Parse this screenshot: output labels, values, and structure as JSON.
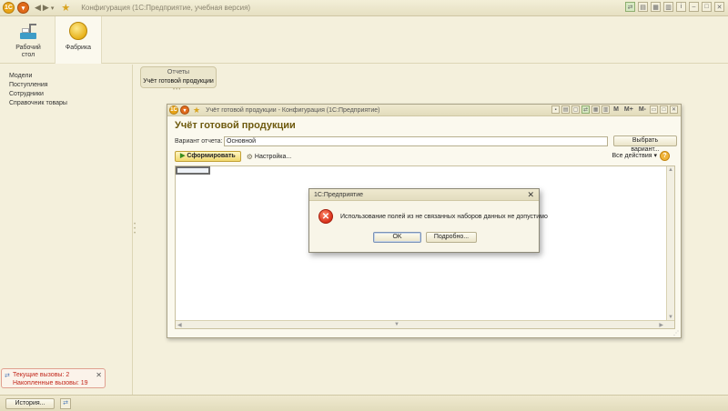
{
  "window": {
    "title": "Конфигурация  (1С:Предприятие, учебная версия)"
  },
  "sections": [
    {
      "label": "Рабочий стол",
      "icon": "desktop-icon",
      "active": false
    },
    {
      "label": "Фабрика",
      "icon": "coin-icon",
      "active": true
    }
  ],
  "sidebar": {
    "items": [
      "Модели",
      "Поступления",
      "Сотрудники",
      "Справочник товары"
    ]
  },
  "reports": {
    "header": "Отчеты",
    "item": "Учёт готовой продукции"
  },
  "form": {
    "window_title": "Учёт готовой продукции - Конфигурация  (1С:Предприятие)",
    "header": "Учёт готовой продукции",
    "variant_label": "Вариант отчета:",
    "variant_value": "Основной",
    "choose_variant": "Выбрать вариант...",
    "generate": "Сформировать",
    "settings": "Настройка...",
    "all_actions": "Все действия ▾",
    "toolbar_m": "M",
    "toolbar_mplus": "M+",
    "toolbar_mminus": "M-"
  },
  "modal": {
    "title": "1С:Предприятие",
    "message": "Использование полей из не связанных наборов данных не допустимо",
    "ok": "OK",
    "details": "Подробно..."
  },
  "service": {
    "current_calls": "Текущие вызовы: 2",
    "accumulated_calls": "Накопленные вызовы: 19"
  },
  "bottom": {
    "history": "История..."
  },
  "colors": {
    "background": "#f4f0dc",
    "header_text": "#6e5a0e",
    "error": "#d7301a",
    "service_text": "#c2271b"
  }
}
